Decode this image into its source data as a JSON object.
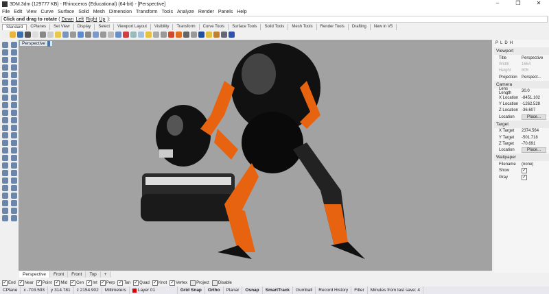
{
  "title": "3DM.3dm (129777 KB) - Rhinoceros (Educational) (64-bit) - [Perspective]",
  "window_controls": [
    "–",
    "❐",
    "✕"
  ],
  "menu": [
    "File",
    "Edit",
    "View",
    "Curve",
    "Surface",
    "Solid",
    "Mesh",
    "Dimension",
    "Transform",
    "Tools",
    "Analyze",
    "Render",
    "Panels",
    "Help"
  ],
  "command": {
    "prompt": "Click and drag to rotate",
    "open": "(",
    "options": [
      "Down",
      "Left",
      "Right",
      "Up"
    ],
    "close": "):"
  },
  "toolbar_tabs": [
    "Standard",
    "CPlanes",
    "Set View",
    "Display",
    "Select",
    "Viewport Layout",
    "Visibility",
    "Transform",
    "Curve Tools",
    "Surface Tools",
    "Solid Tools",
    "Mesh Tools",
    "Render Tools",
    "Drafting",
    "New in V5"
  ],
  "viewport": {
    "name": "Perspective"
  },
  "panel": {
    "tabs": [
      "P",
      "L",
      "D",
      "H"
    ],
    "viewport_section": "Viewport",
    "title_label": "Title",
    "title_value": "Perspective",
    "width_label": "Width",
    "width_value": "1654",
    "height_label": "Height",
    "height_value": "805",
    "projection_label": "Projection",
    "projection_value": "Perspect...",
    "camera_section": "Camera",
    "lens_label": "Lens Length",
    "lens_value": "30.0",
    "xloc_label": "X Location",
    "xloc_value": "-8451.102",
    "yloc_label": "Y Location",
    "yloc_value": "-1262.528",
    "zloc_label": "Z Location",
    "zloc_value": "-36.607",
    "loc_label": "Location",
    "place_label": "Place...",
    "target_section": "Target",
    "xt_label": "X Target",
    "xt_value": "2374.564",
    "yt_label": "Y Target",
    "yt_value": "-501.718",
    "zt_label": "Z Target",
    "zt_value": "-70.691",
    "wallpaper_section": "Wallpaper",
    "filename_label": "Filename",
    "filename_value": "(none)",
    "show_label": "Show",
    "show_checked": true,
    "gray_label": "Gray",
    "gray_checked": true
  },
  "viewport_tabs": [
    "Perspective",
    "Front",
    "Front",
    "Top",
    "+"
  ],
  "osnaps": [
    {
      "label": "End",
      "checked": true
    },
    {
      "label": "Near",
      "checked": true
    },
    {
      "label": "Point",
      "checked": true
    },
    {
      "label": "Mid",
      "checked": true
    },
    {
      "label": "Cen",
      "checked": true
    },
    {
      "label": "Int",
      "checked": true
    },
    {
      "label": "Perp",
      "checked": true
    },
    {
      "label": "Tan",
      "checked": true
    },
    {
      "label": "Quad",
      "checked": true
    },
    {
      "label": "Knot",
      "checked": true
    },
    {
      "label": "Vertex",
      "checked": true
    },
    {
      "label": "Project",
      "checked": false
    },
    {
      "label": "Disable",
      "checked": false
    }
  ],
  "status": {
    "cplane": "CPlane",
    "x": "x -703.593",
    "y": "y 314.781",
    "z": "z 2154.902",
    "units": "Millimeters",
    "layer": "Layer 01",
    "layer_color": "#dd0000",
    "toggles": [
      "Grid Snap",
      "Ortho",
      "Planar",
      "Osnap",
      "SmartTrack",
      "Gumball",
      "Record History",
      "Filter"
    ],
    "save_msg": "Minutes from last save: 4"
  },
  "colors": {
    "viewport_bg": "#a2a2a2",
    "robot_orange": "#e8630f",
    "robot_black": "#111111"
  }
}
